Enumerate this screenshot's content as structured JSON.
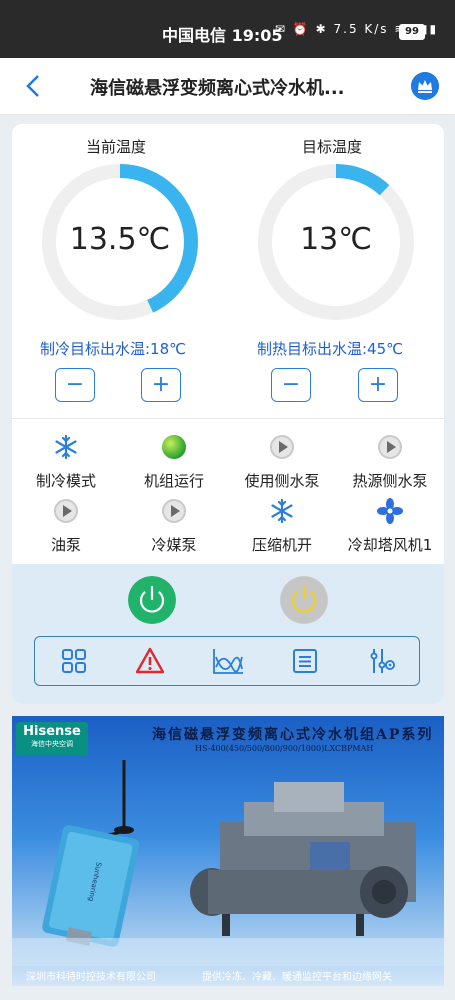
{
  "status_bar": {
    "carrier_time": "中国电信 19:05",
    "net_speed": "7.5 K/s",
    "battery": "99"
  },
  "header": {
    "title": "海信磁悬浮变频离心式冷水机..."
  },
  "gauges": [
    {
      "label": "当前温度",
      "value": "13.5℃",
      "level": 0.43,
      "setpoint_label": "制冷目标出水温:18℃"
    },
    {
      "label": "目标温度",
      "value": "13℃",
      "level": 0.12,
      "setpoint_label": "制热目标出水温:45℃"
    }
  ],
  "stepper": {
    "minus": "−",
    "plus": "+"
  },
  "status_items": [
    {
      "label": "制冷模式",
      "icon": "snowflake-icon"
    },
    {
      "label": "机组运行",
      "icon": "green-dot-icon"
    },
    {
      "label": "使用侧水泵",
      "icon": "play-circle-icon"
    },
    {
      "label": "热源侧水泵",
      "icon": "play-circle-icon"
    },
    {
      "label": "油泵",
      "icon": "play-circle-icon"
    },
    {
      "label": "冷媒泵",
      "icon": "play-circle-icon"
    },
    {
      "label": "压缩机开",
      "icon": "snowflake-icon"
    },
    {
      "label": "冷却塔风机1",
      "icon": "fan-icon"
    }
  ],
  "colors": {
    "accent": "#2c7fd8",
    "on": "#21b36a",
    "off": "#c6c6c6",
    "alarm": "#e0282e"
  },
  "toolbar": [
    "grid-icon",
    "alarm-icon",
    "chart-icon",
    "list-icon",
    "settings-icon"
  ],
  "banner": {
    "brand": "Hisense",
    "brand_sub": "海信中央空调",
    "title": "海信磁悬浮变频离心式冷水机组AP系列",
    "model": "HS-400(450/500/800/900/1000)LXCBPMAH",
    "footer_left": "深圳市科特时控技术有限公司",
    "footer_right": "提供冷冻、冷藏、暖通监控平台和边缘网关",
    "device_label": "Sunhearing"
  }
}
